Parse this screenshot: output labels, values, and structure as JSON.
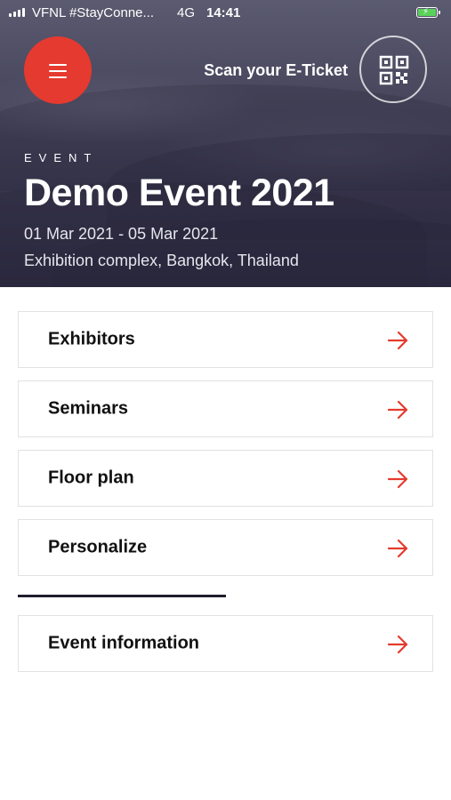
{
  "status_bar": {
    "carrier": "VFNL #StayConne...",
    "network": "4G",
    "time": "14:41"
  },
  "header": {
    "scan_label": "Scan your E-Ticket",
    "menu_icon": "hamburger-menu-icon",
    "qr_icon": "qr-code-icon"
  },
  "event": {
    "eyebrow": "EVENT",
    "title": "Demo Event 2021",
    "dates": "01 Mar 2021 - 05 Mar 2021",
    "venue": "Exhibition complex, Bangkok, Thailand"
  },
  "menu": {
    "items": [
      {
        "label": "Exhibitors"
      },
      {
        "label": "Seminars"
      },
      {
        "label": "Floor plan"
      },
      {
        "label": "Personalize"
      }
    ],
    "secondary": [
      {
        "label": "Event information"
      }
    ]
  },
  "colors": {
    "accent": "#e53a2f",
    "hero_dark": "#2b2940",
    "battery": "#5ad15a"
  }
}
